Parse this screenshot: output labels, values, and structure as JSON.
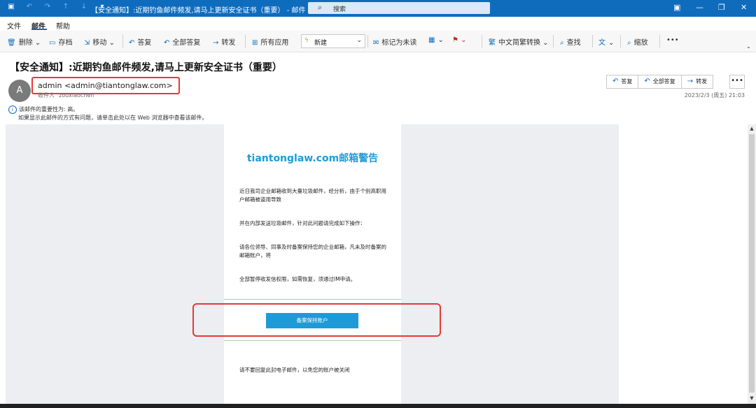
{
  "titlebar": {
    "title": "【安全通知】:近期钓鱼邮件频发,请马上更新安全证书（重要） - 邮件 (HT...",
    "search_placeholder": "搜索"
  },
  "menu": {
    "items": [
      "文件",
      "邮件",
      "帮助"
    ],
    "active": "邮件"
  },
  "toolbar": {
    "delete": "删除",
    "archive": "存档",
    "move": "移动",
    "reply": "答复",
    "reply_all": "全部答复",
    "forward": "转发",
    "all_apps": "所有应用",
    "style": "新建",
    "mark_unread": "标记为未读",
    "convert": "中文简繁转换",
    "find": "查找",
    "zoom": "缩放"
  },
  "message": {
    "subject": "【安全通知】:近期钓鱼邮件频发,请马上更新安全证书（重要）",
    "avatar_letter": "A",
    "sender": "admin <admin@tiantonglaw.com>",
    "to_label": "收件人",
    "to": "zouxiaochen",
    "date": "2023/2/3 (周五) 21:03",
    "importance": "该邮件的重要性为: 高。",
    "browser_hint": "如果显示此邮件的方式有问题，请单击此处以在 Web 浏览器中查看该邮件。"
  },
  "actions": {
    "reply": "答复",
    "reply_all": "全部答复",
    "forward": "转发"
  },
  "email_body": {
    "heading": "tiantonglaw.com邮箱警告",
    "p1": "近日我司企业邮箱收到大量垃圾邮件，经分析，由于个别高职用户邮箱被盗用导致",
    "p2": "并在内部发送垃圾邮件，针对此问题请完成如下操作：",
    "p3": "请各位领导、同事及时备案保持您的企业邮箱，凡未及时备案的邮箱账户，将",
    "p4": "全部暂停收发信权限，如需恢复，须通过IM申请。",
    "button": "备案保持账户",
    "footer": "请不要回复此封电子邮件，以免您的账户被关闭"
  },
  "colors": {
    "accent": "#0f6cbd",
    "mail_blue": "#1e9bd7",
    "highlight_red": "#e53935"
  }
}
